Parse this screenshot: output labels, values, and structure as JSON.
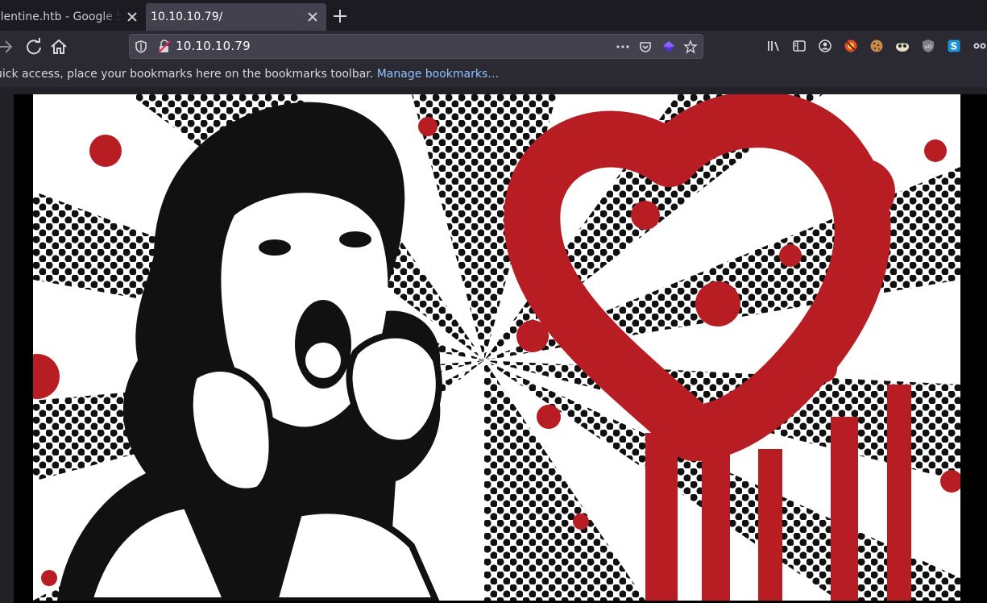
{
  "tabs": [
    {
      "title": "alentine.htb - Google Se",
      "active": false
    },
    {
      "title": "10.10.10.79/",
      "active": true
    }
  ],
  "urlbar": {
    "url": "10.10.10.79"
  },
  "bookmarks_bar": {
    "message": "uick access, place your bookmarks here on the bookmarks toolbar. ",
    "manage_link": "Manage bookmarks…"
  },
  "icons": {
    "nav": [
      "back-icon",
      "reload-icon",
      "home-icon"
    ],
    "urlbar": [
      "tracking-shield-icon",
      "insecure-connection-icon",
      "page-actions-icon",
      "pocket-icon",
      "extension-icon",
      "bookmark-star-icon"
    ],
    "toolbar": [
      "library-icon",
      "sidebar-icon",
      "account-icon",
      "addon-red-icon",
      "cookie-icon",
      "addon-face-icon",
      "ublock-icon",
      "shield-addon-icon",
      "s-addon-icon",
      "overflow-addon-icon"
    ]
  },
  "colors": {
    "accent_red": "#b81d24",
    "link": "#8fc3ff",
    "urlbar_bg": "#42414d"
  }
}
